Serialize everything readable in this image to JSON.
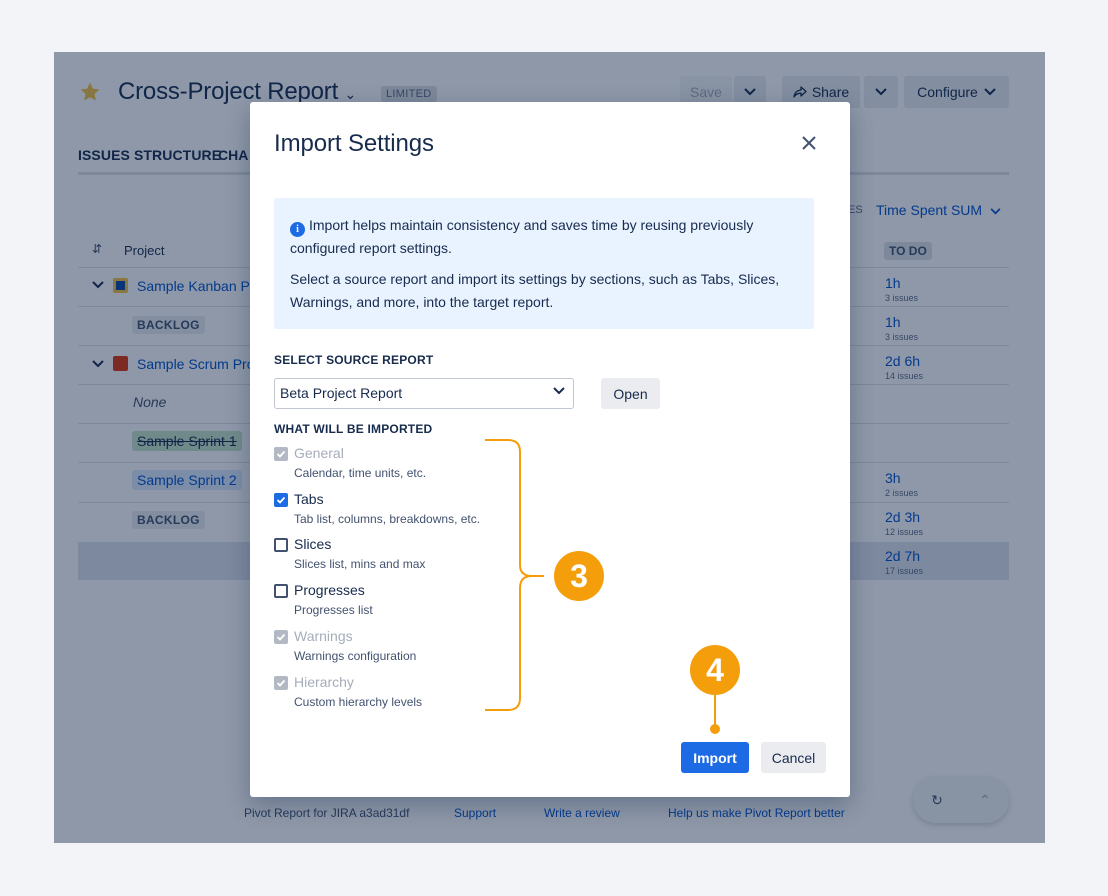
{
  "header": {
    "title": "Cross-Project Report",
    "badge": "LIMITED",
    "save_label": "Save",
    "share_label": "Share",
    "configure_label": "Configure"
  },
  "nav": {
    "tab1": "ISSUES STRUCTURE",
    "tab2": "CHA"
  },
  "table": {
    "col_project": "Project",
    "right_dropdown": "Time Spent SUM",
    "right_partial": "ES",
    "col_todo": "TO DO",
    "rows": [
      {
        "label": "Sample Kanban Pr",
        "value": "1h",
        "count": "3 issues"
      },
      {
        "label": "BACKLOG",
        "value": "1h",
        "count": "3 issues"
      },
      {
        "label": "Sample Scrum Pro",
        "value": "2d 6h",
        "count": "14 issues"
      },
      {
        "label": "None",
        "value": "",
        "count": ""
      },
      {
        "label": "Sample Sprint 1",
        "value": "",
        "count": ""
      },
      {
        "label": "Sample Sprint 2",
        "value": "3h",
        "count": "2 issues"
      },
      {
        "label": "BACKLOG",
        "value": "2d 3h",
        "count": "12 issues"
      },
      {
        "label": "",
        "value": "2d 7h",
        "count": "17 issues"
      }
    ]
  },
  "footer": {
    "version": "Pivot Report for JIRA a3ad31df",
    "support": "Support",
    "review": "Write a review",
    "help": "Help us make Pivot Report better"
  },
  "modal": {
    "title": "Import Settings",
    "info_p1": "Import helps maintain consistency and saves time by reusing previously configured report settings.",
    "info_p2": "Select a source report and import its settings by sections, such as Tabs, Slices, Warnings, and more, into the target report.",
    "source_label": "SELECT SOURCE REPORT",
    "source_value": "Beta Project Report",
    "open_label": "Open",
    "what_label": "WHAT WILL BE IMPORTED",
    "options": [
      {
        "label": "General",
        "desc": "Calendar, time units, etc.",
        "state": "disabled"
      },
      {
        "label": "Tabs",
        "desc": "Tab list, columns, breakdowns, etc.",
        "state": "checked"
      },
      {
        "label": "Slices",
        "desc": "Slices list, mins and max",
        "state": "unchecked"
      },
      {
        "label": "Progresses",
        "desc": "Progresses list",
        "state": "unchecked"
      },
      {
        "label": "Warnings",
        "desc": "Warnings configuration",
        "state": "disabled"
      },
      {
        "label": "Hierarchy",
        "desc": "Custom hierarchy levels",
        "state": "disabled"
      }
    ],
    "import_label": "Import",
    "cancel_label": "Cancel"
  },
  "annotations": {
    "step3": "3",
    "step4": "4",
    "accent_color": "#f59e0b"
  }
}
